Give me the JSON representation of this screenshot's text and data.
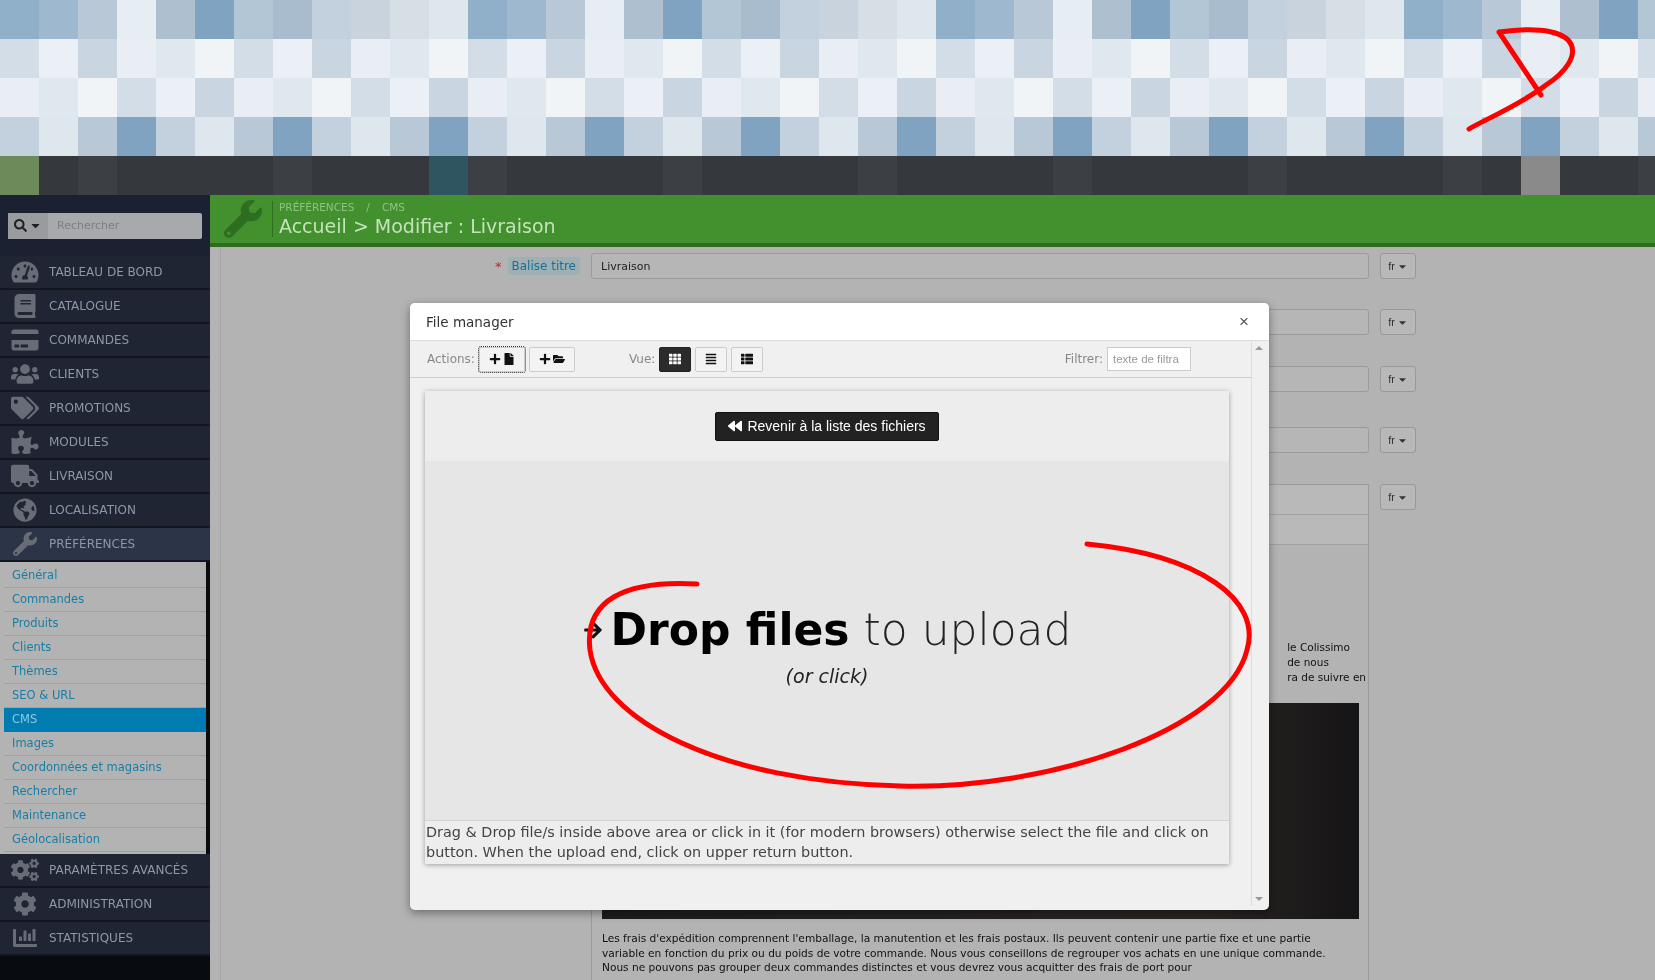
{
  "sidebar": {
    "search": {
      "placeholder": "Rechercher"
    },
    "menu": [
      {
        "label": "TABLEAU DE BORD",
        "selected": false
      },
      {
        "label": "CATALOGUE",
        "selected": false
      },
      {
        "label": "COMMANDES",
        "selected": false
      },
      {
        "label": "CLIENTS",
        "selected": false
      },
      {
        "label": "PROMOTIONS",
        "selected": false
      },
      {
        "label": "MODULES",
        "selected": false
      },
      {
        "label": "LIVRAISON",
        "selected": false
      },
      {
        "label": "LOCALISATION",
        "selected": false
      },
      {
        "label": "PRÉFÉRENCES",
        "selected": true,
        "children": [
          {
            "label": "Général",
            "selected": false
          },
          {
            "label": "Commandes",
            "selected": false
          },
          {
            "label": "Produits",
            "selected": false
          },
          {
            "label": "Clients",
            "selected": false
          },
          {
            "label": "Thèmes",
            "selected": false
          },
          {
            "label": "SEO & URL",
            "selected": false
          },
          {
            "label": "CMS",
            "selected": true
          },
          {
            "label": "Images",
            "selected": false
          },
          {
            "label": "Coordonnées et magasins",
            "selected": false
          },
          {
            "label": "Rechercher",
            "selected": false
          },
          {
            "label": "Maintenance",
            "selected": false
          },
          {
            "label": "Géolocalisation",
            "selected": false
          }
        ]
      },
      {
        "label": "PARAMÈTRES AVANCÉS",
        "selected": false
      },
      {
        "label": "ADMINISTRATION",
        "selected": false
      },
      {
        "label": "STATISTIQUES",
        "selected": false
      }
    ]
  },
  "header": {
    "breadcrumb": [
      "PRÉFÉRENCES",
      "CMS"
    ],
    "separator": "/",
    "title": "Accueil > Modifier : Livraison"
  },
  "form": {
    "required_mark": "*",
    "label": "Balise titre",
    "value": "Livraison",
    "language_buttons": [
      "fr",
      "fr",
      "fr",
      "fr",
      "fr"
    ]
  },
  "content": {
    "fragments": [
      "le Colissimo",
      "de nous",
      "ra de suivre en"
    ],
    "paragraph": "Les frais d'expédition comprennent l'emballage, la manutention et les frais postaux. Ils peuvent contenir une partie fixe et une partie variable en fonction du prix ou du poids de votre commande. Nous vous conseillons de regrouper vos achats en une unique commande. Nous ne pouvons pas grouper deux commandes distinctes et vous devrez vous acquitter des frais de port pour"
  },
  "modal": {
    "title": "File manager",
    "close": "×",
    "actions_label": "Actions:",
    "view_label": "Vue:",
    "views": [
      {
        "selected": true
      },
      {
        "selected": false
      },
      {
        "selected": false
      }
    ],
    "filter_label": "Filtrer:",
    "filter_placeholder": "texte de filtra",
    "back_button": "Revenir à la liste des fichiers",
    "drop_heading": "**Drop files** to upload",
    "drop_sub": "(or click)",
    "help": "Drag & Drop file/s inside above area or click in it (for modern browsers) otherwise select the file and click on button. When the upload end, click on upper return button."
  }
}
